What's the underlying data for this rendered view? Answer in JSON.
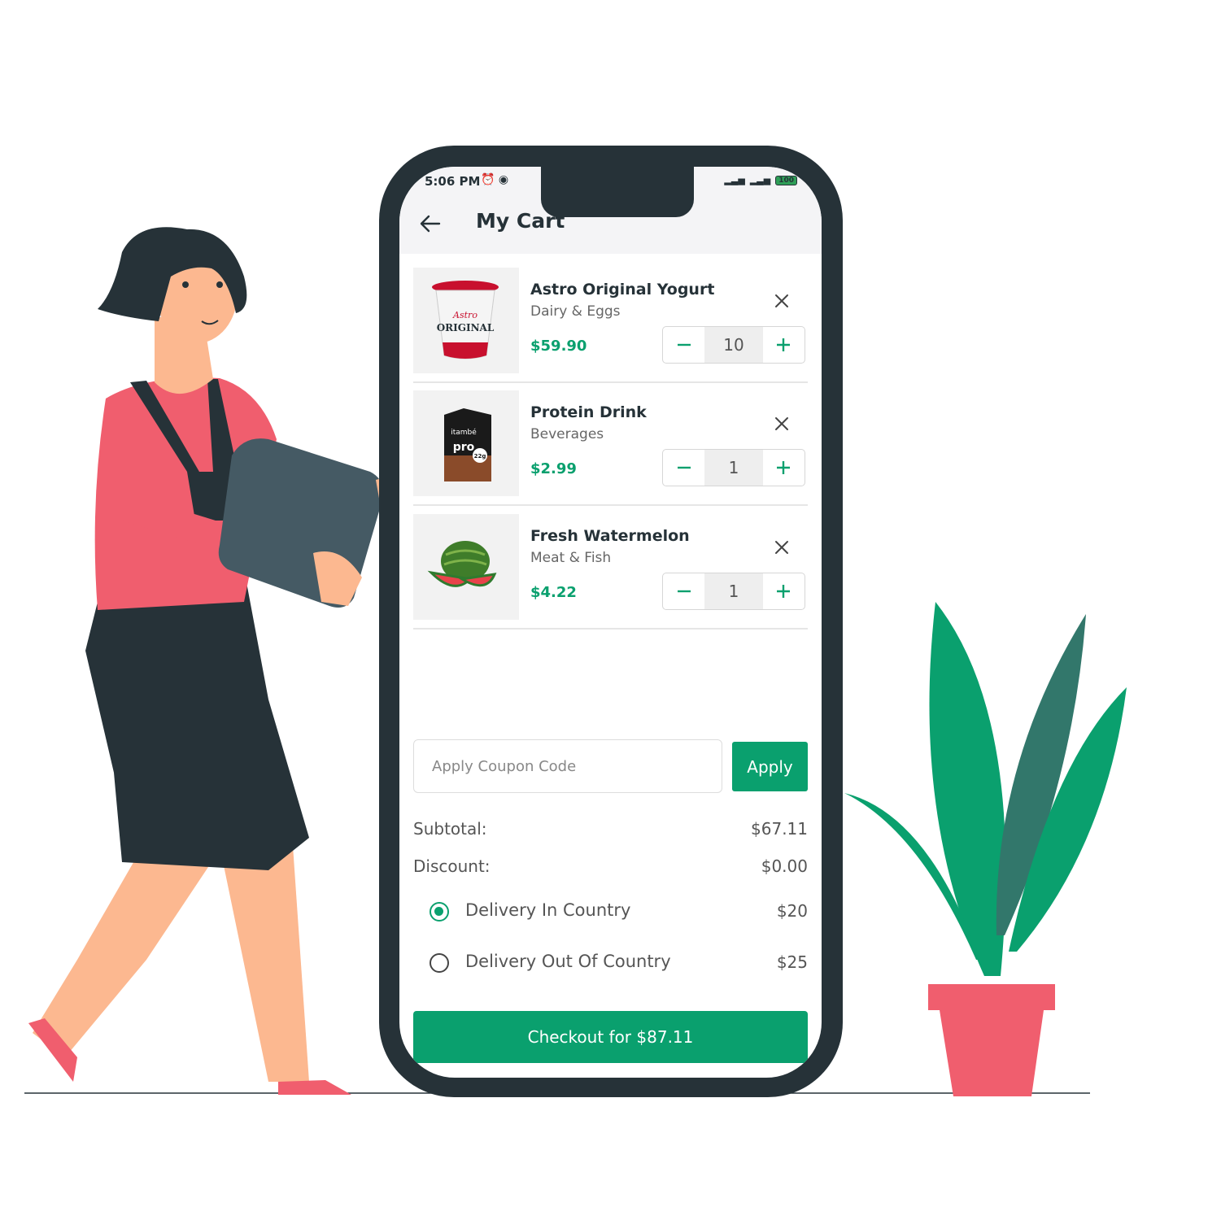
{
  "status_bar": {
    "time": "5:06 PM",
    "battery": "100"
  },
  "header": {
    "title": "My Cart"
  },
  "cart": {
    "items": [
      {
        "name": "Astro Original Yogurt",
        "category": "Dairy & Eggs",
        "price": "$59.90",
        "quantity": "10"
      },
      {
        "name": "Protein Drink",
        "category": "Beverages",
        "price": "$2.99",
        "quantity": "1"
      },
      {
        "name": "Fresh Watermelon",
        "category": "Meat & Fish",
        "price": "$4.22",
        "quantity": "1"
      }
    ]
  },
  "product_labels": {
    "yogurt_brand": "Astro",
    "yogurt_text": "ORIGINAL",
    "drink_brand": "itambé",
    "drink_text": "pro",
    "drink_badge": "22g"
  },
  "coupon": {
    "placeholder": "Apply Coupon Code",
    "apply_label": "Apply"
  },
  "summary": {
    "subtotal_label": "Subtotal:",
    "subtotal_value": "$67.11",
    "discount_label": "Discount:",
    "discount_value": "$0.00",
    "delivery_options": [
      {
        "label": "Delivery In Country",
        "price": "$20",
        "selected": true
      },
      {
        "label": "Delivery Out Of Country",
        "price": "$25",
        "selected": false
      }
    ]
  },
  "checkout": {
    "label": "Checkout for $87.11"
  },
  "colors": {
    "accent": "#0aa06e",
    "frame": "#263238",
    "pink": "#f05e6e"
  }
}
